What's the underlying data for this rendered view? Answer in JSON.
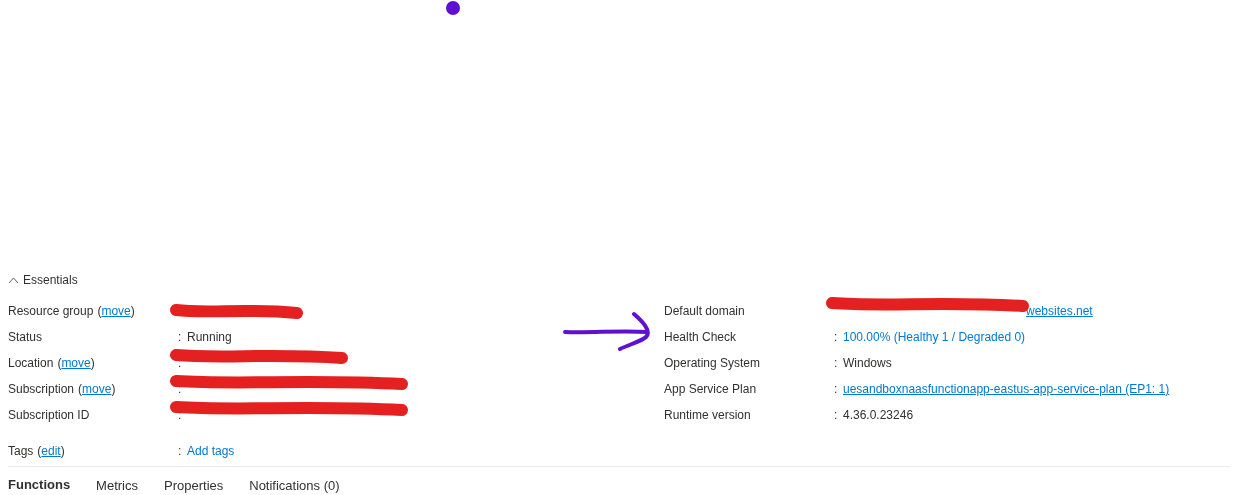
{
  "essentials": {
    "title": "Essentials",
    "expanded": true,
    "left": [
      {
        "label": "Resource group",
        "link": "(move)",
        "redacted": true
      },
      {
        "label": "Status",
        "separator": ":",
        "value": "Running",
        "kind": "text"
      },
      {
        "label": "Location",
        "link": "(move)",
        "separator": ":",
        "redacted": true
      },
      {
        "label": "Subscription",
        "link": "(move)",
        "separator": ":",
        "redacted": true
      },
      {
        "label": "Subscription ID",
        "separator": ":",
        "redacted": true
      }
    ],
    "right": [
      {
        "label": "Default domain",
        "value": "websites.net",
        "kind": "link",
        "redacted": true
      },
      {
        "label": "Health Check",
        "separator": ":",
        "value": "100.00% (Healthy 1 / Degraded 0)",
        "kind": "action"
      },
      {
        "label": "Operating System",
        "separator": ":",
        "value": "Windows",
        "kind": "text"
      },
      {
        "label": "App Service Plan",
        "separator": ":",
        "value": "uesandboxnaasfunctionapp-eastus-app-service-plan (EP1: 1)",
        "kind": "link"
      },
      {
        "label": "Runtime version",
        "separator": ":",
        "value": "4.36.0.23246",
        "kind": "text"
      }
    ],
    "tags": {
      "label": "Tags",
      "link": "(edit)",
      "separator": ":",
      "value": "Add tags",
      "kind": "action"
    }
  },
  "tabs": [
    {
      "label": "Functions",
      "selected": true
    },
    {
      "label": "Metrics",
      "selected": false
    },
    {
      "label": "Properties",
      "selected": false
    },
    {
      "label": "Notifications (0)",
      "selected": false
    }
  ]
}
